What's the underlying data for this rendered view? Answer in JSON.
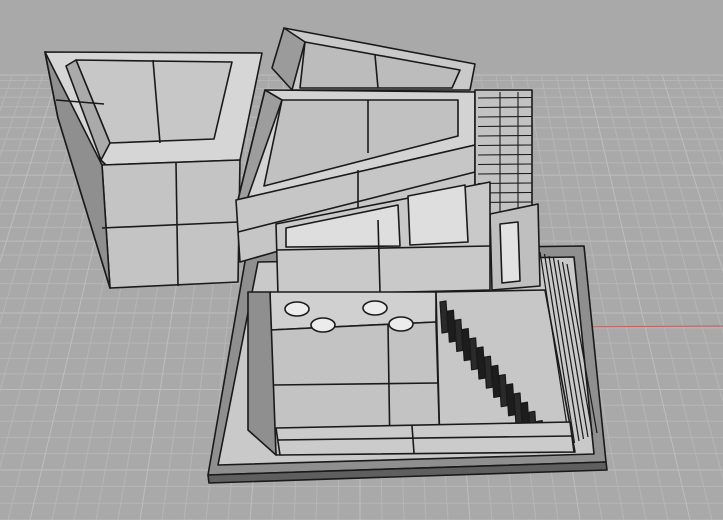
{
  "viewport": {
    "view": "perspective",
    "display_mode": "shaded",
    "grid": true,
    "colors": {
      "background": "#a9a9a9",
      "grid_minor": "#b6b6b6",
      "grid_major": "#bebebe",
      "x_axis": "#c06060",
      "model_face_light": "#cfcfcf",
      "model_face_mid": "#b8b8b8",
      "model_face_dark": "#8f8f8f",
      "model_face_top": "#d8d8d8",
      "edges": "#1a1a1a"
    }
  },
  "model": {
    "type": "architectural-massing-model",
    "parts": [
      "tower-block",
      "rear-angled-block",
      "central-block",
      "stair-tower",
      "base-plate",
      "front-block",
      "staircase"
    ],
    "visible_openings": 4,
    "stair_steps_visible": 14
  }
}
